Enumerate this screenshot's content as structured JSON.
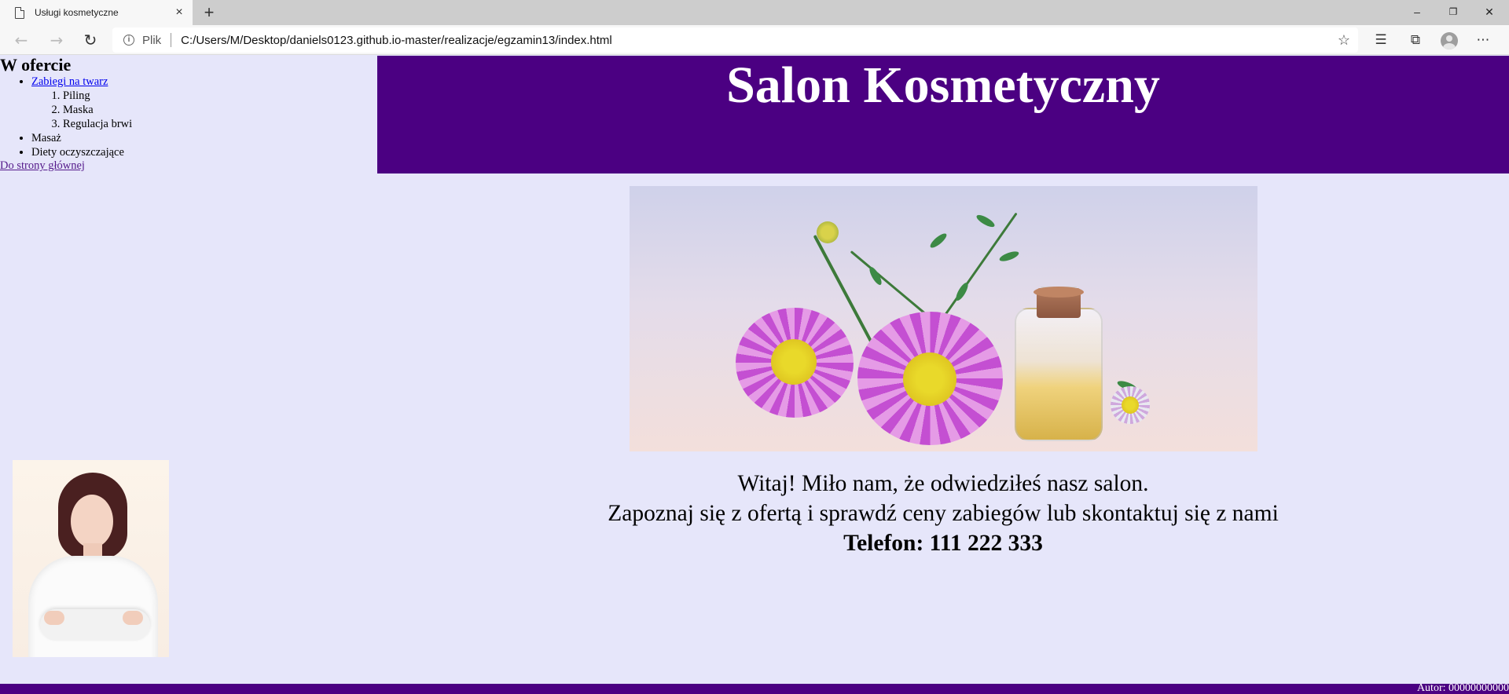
{
  "browser": {
    "tab_title": "Usługi kosmetyczne",
    "tab_close": "×",
    "new_tab": "+",
    "scheme_label": "Plik",
    "url": "C:/Users/M/Desktop/daniels0123.github.io-master/realizacje/egzamin13/index.html",
    "icons": {
      "back": "back-arrow-icon",
      "forward": "forward-arrow-icon",
      "reload": "reload-icon",
      "info": "info-icon",
      "favorite": "star-icon",
      "favorites_list": "favorites-list-icon",
      "collections": "collections-icon",
      "profile": "profile-icon",
      "more": "more-icon"
    },
    "window": {
      "minimize": "–",
      "restore": "❐",
      "close": "✕"
    }
  },
  "sidebar": {
    "heading": "W ofercie",
    "items": [
      {
        "label": "Zabiegi na twarz",
        "is_link": true,
        "subitems": [
          "Piling",
          "Maska",
          "Regulacja brwi"
        ]
      },
      {
        "label": "Masaż",
        "is_link": false
      },
      {
        "label": "Diety oczyszczające",
        "is_link": false
      }
    ],
    "home_link": "Do strony głównej"
  },
  "header": {
    "title": "Salon Kosmetyczny"
  },
  "main": {
    "line1": "Witaj! Miło nam, że odwiedziłeś nasz salon.",
    "line2": "Zapoznaj się z ofertą i sprawdź ceny zabiegów lub skontaktuj się z nami",
    "phone": "Telefon: 111 222 333"
  },
  "footer": {
    "author": "Autor: 00000000000"
  },
  "colors": {
    "page_bg": "#e6e6fa",
    "header_bg": "#4b0082",
    "footer_bg": "#4b0082",
    "link": "#0000ee",
    "visited_link": "#551a8b"
  }
}
